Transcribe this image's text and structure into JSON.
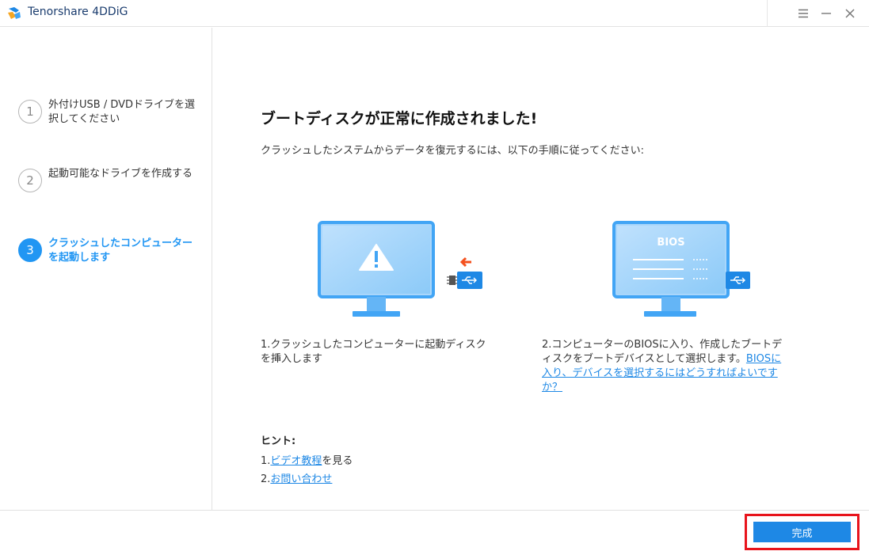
{
  "app": {
    "title": "Tenorshare 4DDiG"
  },
  "window_controls": {
    "menu_icon": "hamburger-menu-icon",
    "minimize_icon": "minimize-icon",
    "close_icon": "close-icon"
  },
  "steps": [
    {
      "number": "1",
      "label": "外付けUSB / DVDドライブを選択してください"
    },
    {
      "number": "2",
      "label": "起動可能なドライブを作成する"
    },
    {
      "number": "3",
      "label": "クラッシュしたコンピューターを起動します",
      "active": true
    }
  ],
  "main": {
    "headline": "ブートディスクが正常に作成されました!",
    "subtitle": "クラッシュしたシステムからデータを復元するには、以下の手順に従ってください:",
    "instruction1": {
      "text": "1.クラッシュしたコンピューターに起動ディスクを挿入します",
      "icon": "monitor-warning-usb-icon"
    },
    "instruction2": {
      "text": "2.コンピューターのBIOSに入り、作成したブートディスクをブートデバイスとして選択します。",
      "link": "BIOSに入り、デバイスを選択するにはどうすればよいですか？",
      "bios_label": "BIOS",
      "icon": "monitor-bios-usb-icon"
    }
  },
  "hints": {
    "title": "ヒント:",
    "item1": {
      "prefix": "1.",
      "link": "ビデオ教程",
      "suffix": "を見る"
    },
    "item2": {
      "prefix": "2.",
      "link": "お問い合わせ"
    }
  },
  "footer": {
    "done_label": "完成"
  },
  "colors": {
    "accent": "#1e88e5",
    "highlight": "#e8141c",
    "monitor": "#42a5f5",
    "arrow": "#f4511e"
  }
}
